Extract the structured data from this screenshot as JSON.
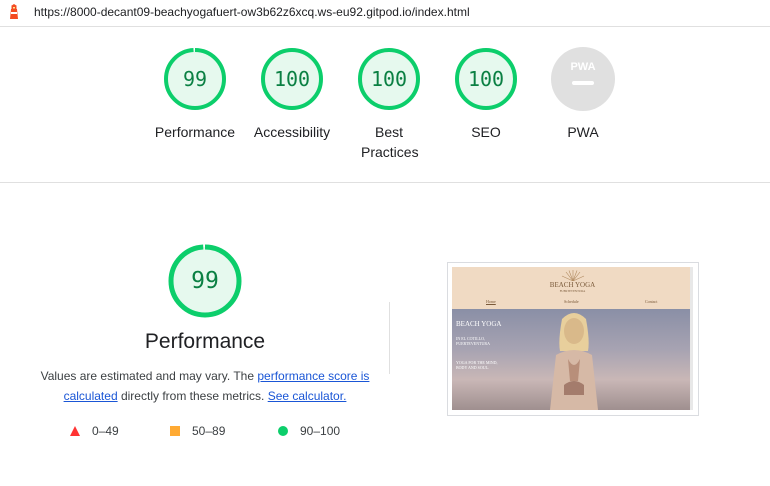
{
  "browser": {
    "url": "https://8000-decant09-beachyogafuert-ow3b62z6xcq.ws-eu92.gitpod.io/index.html"
  },
  "summary_gauges": [
    {
      "score": "99",
      "label": "Performance",
      "fraction": 0.99
    },
    {
      "score": "100",
      "label": "Accessibility",
      "fraction": 1.0
    },
    {
      "score": "100",
      "label": "Best Practices",
      "fraction": 1.0
    },
    {
      "score": "100",
      "label": "SEO",
      "fraction": 1.0
    },
    {
      "score": "",
      "label": "PWA",
      "icon": "pwa-badge-icon"
    }
  ],
  "performance": {
    "score": "99",
    "fraction": 0.99,
    "title": "Performance",
    "desc_prefix": "Values are estimated and may vary. The",
    "link_score": "performance score is calculated",
    "desc_middle": "directly from these metrics.",
    "link_calc": "See calculator."
  },
  "legend": [
    {
      "icon": "triangle-red-icon",
      "range": "0–49",
      "color": "#ff3333"
    },
    {
      "icon": "square-orange-icon",
      "range": "50–89",
      "color": "#ffaa33"
    },
    {
      "icon": "circle-green-icon",
      "range": "90–100",
      "color": "#0cce6b"
    }
  ],
  "screenshot": {
    "logo": "BEACH YOGA",
    "logo_sub": "FUERTEVENTURA",
    "nav": [
      "Home",
      "Schedule",
      "Contact"
    ],
    "hero_title": "BEACH YOGA",
    "hero_line1": "IN EL COTILLO,",
    "hero_line2": "FUERTEVENTURA",
    "hero_line3": "YOGA FOR THE MIND,",
    "hero_line4": "BODY AND SOUL."
  },
  "colors": {
    "pass": "#0cce6b",
    "pass_text": "#0b8043",
    "pass_bg": "#e6f9ee",
    "na": "#e0e0e0"
  }
}
